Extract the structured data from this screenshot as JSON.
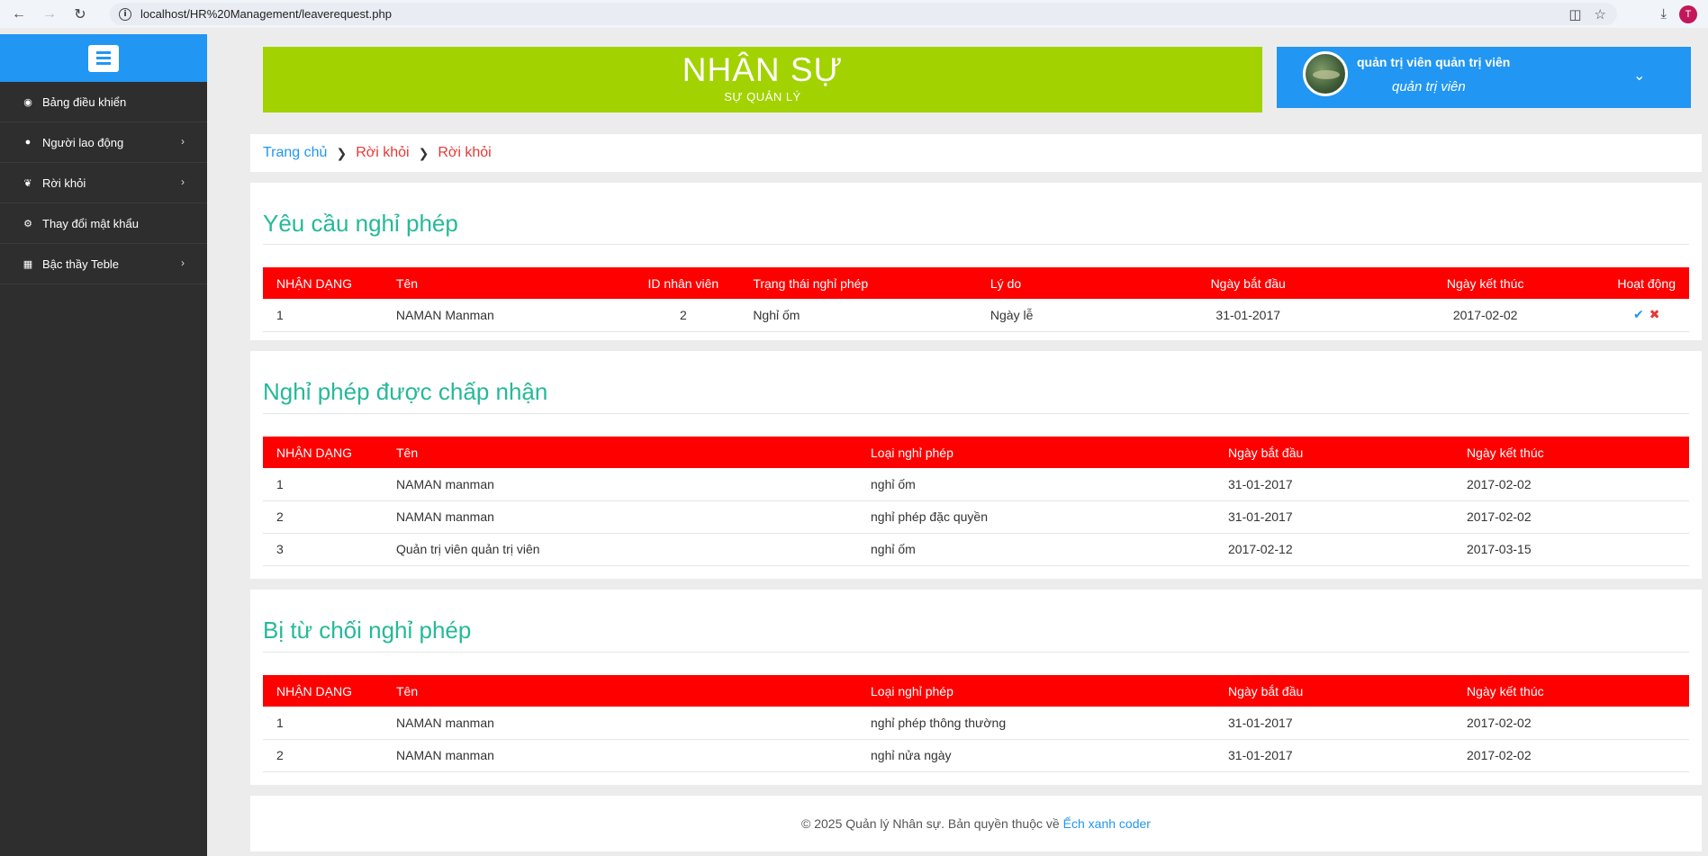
{
  "browser": {
    "url": "localhost/HR%20Management/leaverequest.php",
    "profile_initial": "T"
  },
  "sidebar": {
    "items": [
      {
        "label": "Bảng điều khiển",
        "icon": "dashboard-icon",
        "has_submenu": false
      },
      {
        "label": "Người lao động",
        "icon": "user-icon",
        "has_submenu": true
      },
      {
        "label": "Rời khỏi",
        "icon": "leaf-icon",
        "has_submenu": true
      },
      {
        "label": "Thay đổi mật khẩu",
        "icon": "gears-icon",
        "has_submenu": false
      },
      {
        "label": "Bậc thầy Teble",
        "icon": "table-icon",
        "has_submenu": true
      }
    ]
  },
  "header": {
    "brand_title": "NHÂN SỰ",
    "brand_subtitle": "SỰ QUẢN LÝ",
    "user_name": "quản trị viên quản trị viên",
    "user_role": "quản trị viên"
  },
  "breadcrumb": {
    "home": "Trang chủ",
    "item1": "Rời khỏi",
    "item2": "Rời khỏi"
  },
  "requests": {
    "title": "Yêu cầu nghỉ phép",
    "headers": [
      "NHẬN DẠNG",
      "Tên",
      "ID nhân viên",
      "Trạng thái nghỉ phép",
      "Lý do",
      "Ngày bắt đầu",
      "Ngày kết thúc",
      "Hoạt động"
    ],
    "rows": [
      {
        "id": "1",
        "name": "NAMAN Manman",
        "emp_id": "2",
        "status": "Nghỉ ốm",
        "reason": "Ngày lễ",
        "start": "31-01-2017",
        "end": "2017-02-02"
      }
    ]
  },
  "accepted": {
    "title": "Nghỉ phép được chấp nhận",
    "headers": [
      "NHẬN DẠNG",
      "Tên",
      "Loại nghỉ phép",
      "Ngày bắt đầu",
      "Ngày kết thúc"
    ],
    "rows": [
      {
        "id": "1",
        "name": "NAMAN manman",
        "type": "nghỉ ốm",
        "start": "31-01-2017",
        "end": "2017-02-02"
      },
      {
        "id": "2",
        "name": "NAMAN manman",
        "type": "nghỉ phép đặc quyền",
        "start": "31-01-2017",
        "end": "2017-02-02"
      },
      {
        "id": "3",
        "name": "Quản trị viên quản trị viên",
        "type": "nghỉ ốm",
        "start": "2017-02-12",
        "end": "2017-03-15"
      }
    ]
  },
  "rejected": {
    "title": "Bị từ chối nghỉ phép",
    "headers": [
      "NHẬN DẠNG",
      "Tên",
      "Loại nghỉ phép",
      "Ngày bắt đầu",
      "Ngày kết thúc"
    ],
    "rows": [
      {
        "id": "1",
        "name": "NAMAN manman",
        "type": "nghỉ phép thông thường",
        "start": "31-01-2017",
        "end": "2017-02-02"
      },
      {
        "id": "2",
        "name": "NAMAN manman",
        "type": "nghỉ nửa ngày",
        "start": "31-01-2017",
        "end": "2017-02-02"
      }
    ]
  },
  "footer": {
    "text": "© 2025 Quản lý Nhân sự. Bản quyền thuộc về",
    "link": "Ếch xanh coder"
  },
  "colors": {
    "accent_blue": "#2196f3",
    "brand_green": "#a2d200",
    "table_header_red": "#ff0000",
    "title_teal": "#26b99a",
    "sidebar_dark": "#2e2e2e"
  }
}
